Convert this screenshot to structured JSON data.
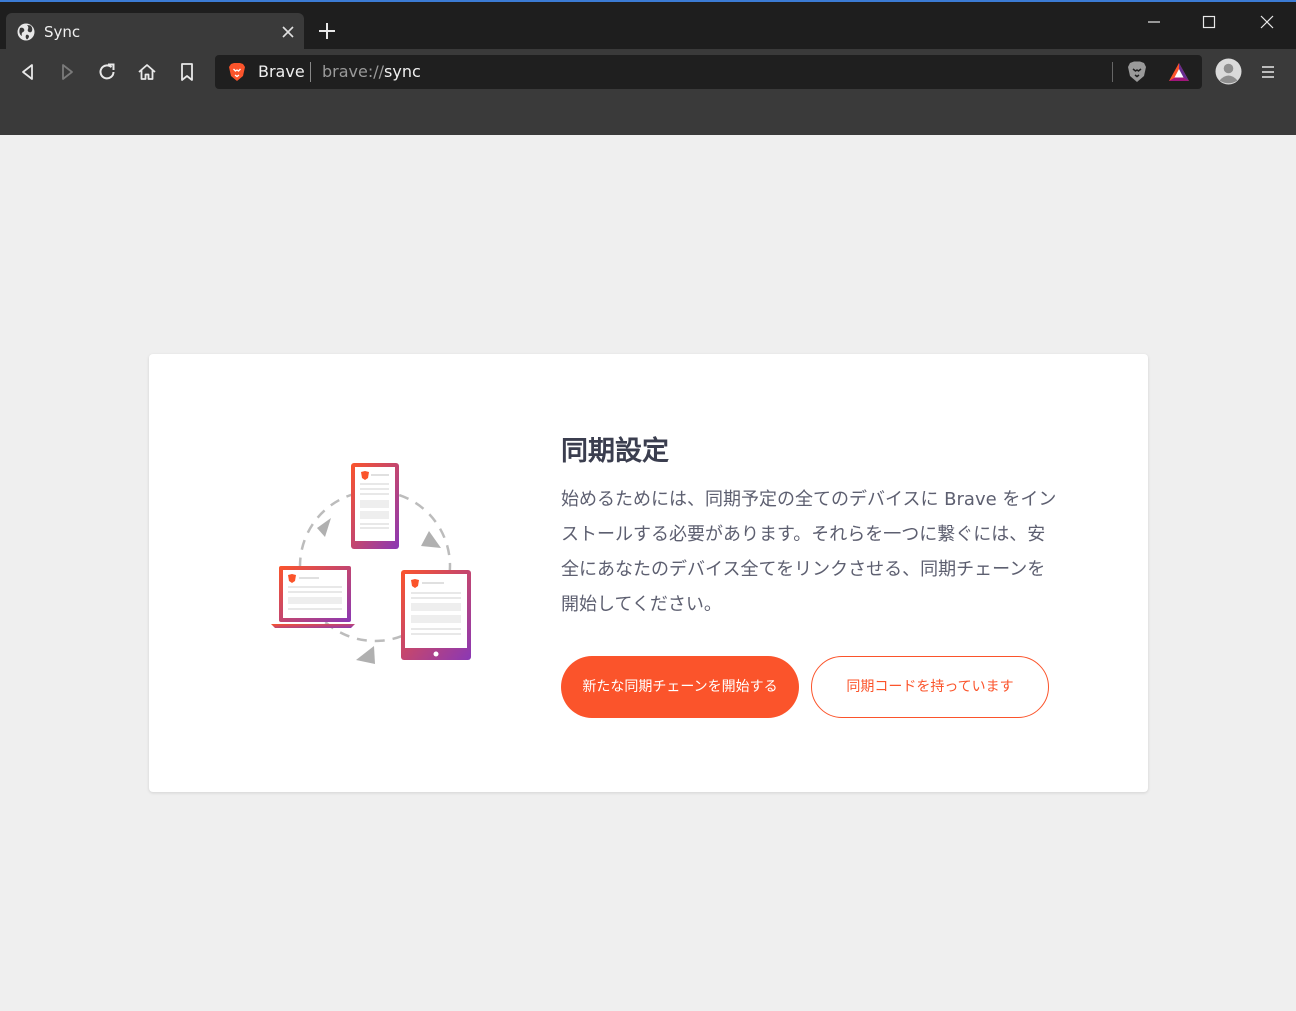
{
  "browser": {
    "tab": {
      "title": "Sync"
    },
    "omnibox": {
      "brand_label": "Brave",
      "url_scheme": "brave://",
      "url_host": "sync"
    },
    "accent": "#fb542b"
  },
  "icons": [
    "globe-icon",
    "close-icon",
    "plus-icon",
    "minimize-icon",
    "maximize-icon",
    "close-window-icon",
    "back-icon",
    "forward-icon",
    "reload-icon",
    "home-icon",
    "bookmark-icon",
    "brave-lion-icon",
    "brave-shields-icon",
    "brave-rewards-icon",
    "profile-avatar-icon",
    "hamburger-menu-icon",
    "sync-devices-illustration"
  ],
  "sync": {
    "title": "同期設定",
    "description": "始めるためには、同期予定の全てのデバイスに Brave をインストールする必要があります。それらを一つに繋ぐには、安全にあなたのデバイス全てをリンクさせる、同期チェーンを開始してください。",
    "start_button": "新たな同期チェーンを開始する",
    "have_code_button": "同期コードを持っています"
  }
}
